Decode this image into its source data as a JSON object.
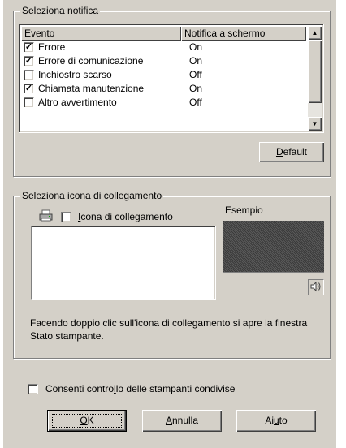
{
  "notification_group": {
    "title": "Seleziona notifica",
    "columns": {
      "event": "Evento",
      "screen": "Notifica a schermo"
    },
    "rows": [
      {
        "checked": true,
        "event": "Errore",
        "status": "On"
      },
      {
        "checked": true,
        "event": "Errore di comunicazione",
        "status": "On"
      },
      {
        "checked": false,
        "event": "Inchiostro scarso",
        "status": "Off"
      },
      {
        "checked": true,
        "event": "Chiamata manutenzione",
        "status": "On"
      },
      {
        "checked": false,
        "event": "Altro avvertimento",
        "status": "Off"
      }
    ],
    "default_button": {
      "label_prefix": "",
      "accel": "D",
      "label_rest": "efault"
    }
  },
  "shortcut_group": {
    "title": "Seleziona icona di collegamento",
    "checkbox": {
      "checked": false,
      "accel": "I",
      "label_rest": "cona di collegamento"
    },
    "example_label": "Esempio",
    "info_text": "Facendo doppio clic sull'icona di collegamento si apre la finestra Stato stampante."
  },
  "shared_printers": {
    "checked": false,
    "label_prefix": "Consenti contro",
    "accel": "l",
    "label_rest": "lo delle stampanti condivise"
  },
  "buttons": {
    "ok": {
      "accel": "O",
      "label_rest": "K"
    },
    "cancel": {
      "accel": "A",
      "label_rest": "nnulla"
    },
    "help": {
      "label_prefix": "Ai",
      "accel": "u",
      "label_rest": "to"
    }
  }
}
